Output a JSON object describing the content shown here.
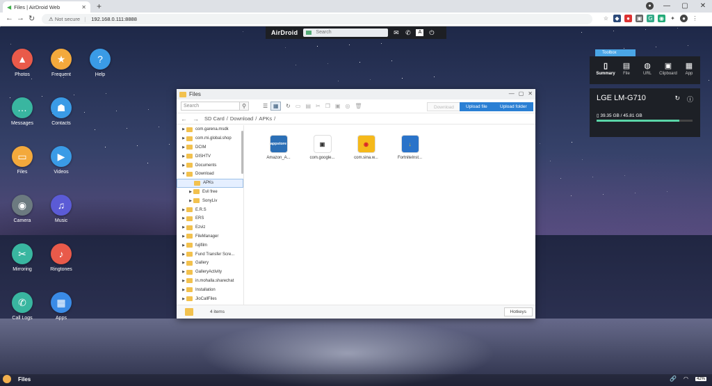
{
  "browser": {
    "tab_title": "Files | AirDroid Web",
    "new_tab": "+",
    "not_secure": "Not secure",
    "url": "192.168.0.111:8888",
    "account_initial": "x"
  },
  "topbar": {
    "brand": "AirDroid",
    "search_placeholder": "Search"
  },
  "apps": [
    {
      "label": "Photos",
      "color": "#e95a4a",
      "icon": "▲"
    },
    {
      "label": "Frequent",
      "color": "#f3a93c",
      "icon": "★"
    },
    {
      "label": "Help",
      "color": "#3a9be6",
      "icon": "?"
    },
    {
      "label": "Messages",
      "color": "#39b6a0",
      "icon": "…"
    },
    {
      "label": "Contacts",
      "color": "#3a9be6",
      "icon": "☗"
    },
    {
      "label": "Files",
      "color": "#f3a93c",
      "icon": "▭"
    },
    {
      "label": "Videos",
      "color": "#3a9be6",
      "icon": "▶"
    },
    {
      "label": "Camera",
      "color": "#6c7a80",
      "icon": "◉"
    },
    {
      "label": "Music",
      "color": "#5b5bd6",
      "icon": "♫"
    },
    {
      "label": "Mirroring",
      "color": "#39b6a0",
      "icon": "✂"
    },
    {
      "label": "Ringtones",
      "color": "#e95a4a",
      "icon": "♪"
    },
    {
      "label": "Call Logs",
      "color": "#39b6a0",
      "icon": "✆"
    },
    {
      "label": "Apps",
      "color": "#3a8be6",
      "icon": "▦"
    }
  ],
  "files_window": {
    "title": "Files",
    "search_placeholder": "Search",
    "btn_download": "Download",
    "btn_upload_file": "Upload file",
    "btn_upload_folder": "Upload folder",
    "breadcrumb": [
      "SD Card",
      "Download",
      "APKs"
    ],
    "tree": [
      {
        "label": "com.garena.msdk",
        "level": 0
      },
      {
        "label": "com.mi.global.shop",
        "level": 0
      },
      {
        "label": "DCIM",
        "level": 0
      },
      {
        "label": "DISHTV",
        "level": 0
      },
      {
        "label": "Documents",
        "level": 0
      },
      {
        "label": "Download",
        "level": 0,
        "open": true
      },
      {
        "label": "APKs",
        "level": 1,
        "selected": true
      },
      {
        "label": "Evil free",
        "level": 1
      },
      {
        "label": "SonyLiv",
        "level": 1
      },
      {
        "label": "E.R.S",
        "level": 0
      },
      {
        "label": "ERS",
        "level": 0
      },
      {
        "label": "Ezviz",
        "level": 0
      },
      {
        "label": "FileManager",
        "level": 0
      },
      {
        "label": "fujifilm",
        "level": 0
      },
      {
        "label": "Fund Transfer Scre...",
        "level": 0
      },
      {
        "label": "Gallery",
        "level": 0
      },
      {
        "label": "GalleryActivity",
        "level": 0
      },
      {
        "label": "in.mohalla.sharechat",
        "level": 0
      },
      {
        "label": "Installation",
        "level": 0
      },
      {
        "label": "JioCallFiles",
        "level": 0
      }
    ],
    "files": [
      {
        "name": "Amazon_A...",
        "badge": "appstore",
        "bg": "#ffffff",
        "fg": "#2b6fb6"
      },
      {
        "name": "com.google...",
        "badge": "▣",
        "bg": "#ffffff",
        "fg": "#333"
      },
      {
        "name": "com.sina.w...",
        "badge": "◉",
        "bg": "#f5b91b",
        "fg": "#d9232a"
      },
      {
        "name": "FortniteInst...",
        "badge": "↓",
        "bg": "#2a73c9",
        "fg": "#f5c21b"
      }
    ],
    "item_count": "4 items",
    "hotkeys": "Hotkeys"
  },
  "toolbox": {
    "label": "Toolbox",
    "items": [
      {
        "label": "Summary",
        "icon": "▯"
      },
      {
        "label": "File",
        "icon": "▤"
      },
      {
        "label": "URL",
        "icon": "◍"
      },
      {
        "label": "Clipboard",
        "icon": "▣"
      },
      {
        "label": "App",
        "icon": "▦"
      }
    ]
  },
  "device": {
    "name": "LGE LM-G710",
    "storage": "39.35 GB / 45.81 GB",
    "storage_fraction": 0.859
  },
  "taskbar": {
    "active_task": "Files",
    "battery": "42%"
  }
}
